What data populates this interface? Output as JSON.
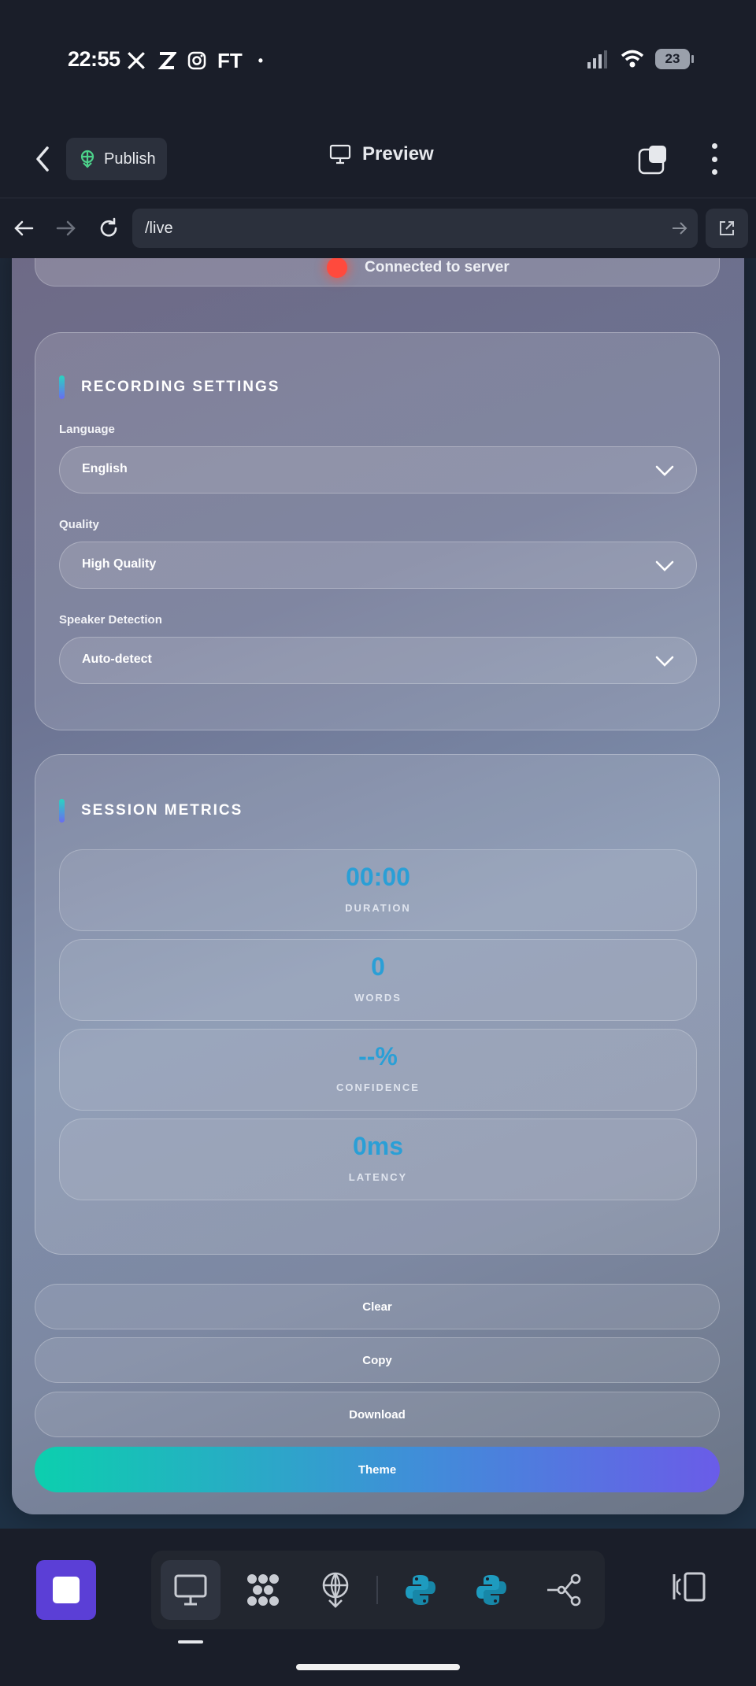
{
  "status_bar": {
    "time": "22:55",
    "left_icons": [
      "x-icon",
      "z-icon",
      "instagram-icon"
    ],
    "ft_label": "FT",
    "dot": "•",
    "battery": "23"
  },
  "header": {
    "publish_label": "Publish",
    "preview_label": "Preview"
  },
  "browser": {
    "url": "/live"
  },
  "connection": {
    "status_text": "Connected to server",
    "dot_color": "#ff4a3d"
  },
  "recording_settings": {
    "title": "RECORDING SETTINGS",
    "fields": [
      {
        "label": "Language",
        "value": "English"
      },
      {
        "label": "Quality",
        "value": "High Quality"
      },
      {
        "label": "Speaker Detection",
        "value": "Auto-detect"
      }
    ]
  },
  "session_metrics": {
    "title": "SESSION METRICS",
    "metrics": [
      {
        "value": "00:00",
        "label": "DURATION"
      },
      {
        "value": "0",
        "label": "WORDS"
      },
      {
        "value": "--%",
        "label": "CONFIDENCE"
      },
      {
        "value": "0ms",
        "label": "LATENCY"
      }
    ],
    "value_color": "#2a9fd6"
  },
  "actions": {
    "clear": "Clear",
    "copy": "Copy",
    "download": "Download",
    "theme": "Theme"
  },
  "toolbar": {
    "tools": [
      "desktop-icon",
      "dots-icon",
      "satellite-icon",
      "python-icon",
      "python-icon",
      "share-node-icon"
    ],
    "accent": "#5b3fd6"
  }
}
